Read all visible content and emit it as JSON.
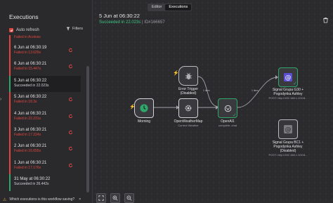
{
  "sidebar": {
    "title": "Executions",
    "auto_refresh_label": "Auto refresh",
    "filters_label": "Filters",
    "partial_top": "Failed in Acotoss",
    "items": [
      {
        "time": "6 Jun at 06:30:19",
        "status": "Failed in 13.629s",
        "ok": false,
        "retry": true
      },
      {
        "time": "6 Jun at 06:30:21",
        "status": "Failed in 15.447s",
        "ok": false,
        "retry": true
      },
      {
        "time": "5 Jun at 06:30:22",
        "status": "Succeeded in 22.023s",
        "ok": true,
        "retry": false,
        "selected": true
      },
      {
        "time": "5 Jun at 06:30:22",
        "status": "Failed in 18.3s",
        "ok": false,
        "retry": true
      },
      {
        "time": "4 Jun at 06:30:21",
        "status": "Failed in 22.231s",
        "ok": false,
        "retry": true
      },
      {
        "time": "3 Jun at 06:30:21",
        "status": "Failed in 17.224s",
        "ok": false,
        "retry": true
      },
      {
        "time": "2 Jun at 06:30:21",
        "status": "Failed in 16.655s",
        "ok": false,
        "retry": true
      },
      {
        "time": "1 Jun at 06:30:21",
        "status": "Failed in 17.176s",
        "ok": false,
        "retry": true
      },
      {
        "time": "31 May at 06:30:22",
        "status": "Succeeded in 26.442s",
        "ok": true,
        "retry": false
      }
    ],
    "bottom_note": "Which executions is this workflow saving?"
  },
  "tabs": {
    "editor": "Editor",
    "executions": "Executions"
  },
  "execution": {
    "title": "5 Jun at 06:30:22",
    "status": "Succeeded in 22.023s",
    "separator": " | ",
    "id": "ID#166657"
  },
  "nodes": {
    "morning": {
      "label": "Morning"
    },
    "error_trigger": {
      "label": "Error Trigger",
      "sub": "(Disabled)"
    },
    "weather": {
      "label": "OpenWeatherMap",
      "sub": "Current Weather"
    },
    "openai": {
      "label": "OpenAI1",
      "sub": "complete: chat"
    },
    "signal_1": {
      "label": "Signal Grupa G30 +",
      "label2": "Pogodynka Ashley",
      "sub": "POST: http://192.168.1.100:8..."
    },
    "signal_2": {
      "label": "Signal Grupa BC1 +",
      "label2": "Pogodynka Ashley",
      "sub2": "(Disabled)",
      "sub": "POST: http://192.168.1.100:8..."
    }
  },
  "links": {
    "weather_openai": "1 item",
    "openai_signal": "1 item",
    "error_link": "1 item"
  },
  "colors": {
    "accent_red": "#e0463f",
    "success": "#2fa76a",
    "bg": "#2b2b2e"
  }
}
